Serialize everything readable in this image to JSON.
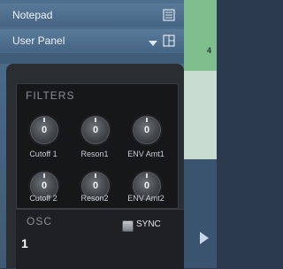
{
  "header": {
    "notepad_label": "Notepad",
    "panel_label": "User Panel"
  },
  "filters": {
    "title": "FILTERS",
    "knobs": [
      {
        "label": "Cutoff 1",
        "value": "0"
      },
      {
        "label": "Reson1",
        "value": "0"
      },
      {
        "label": "ENV Amt1",
        "value": "0"
      },
      {
        "label": "Cutoff 2",
        "value": "0"
      },
      {
        "label": "Reson2",
        "value": "0"
      },
      {
        "label": "ENV Amt2",
        "value": "0"
      }
    ]
  },
  "osc": {
    "title": "OSC",
    "number": "1",
    "sync_label": "SYNC"
  },
  "side_strip": {
    "number": "4"
  },
  "icons": [
    "notepad-icon",
    "chevron-down-icon",
    "panel-layout-icon",
    "play-icon"
  ],
  "colors": {
    "panel_blue": "#4f6f8e",
    "synth_dark": "#2a2d31",
    "strip_green": "#7fbf8d"
  }
}
